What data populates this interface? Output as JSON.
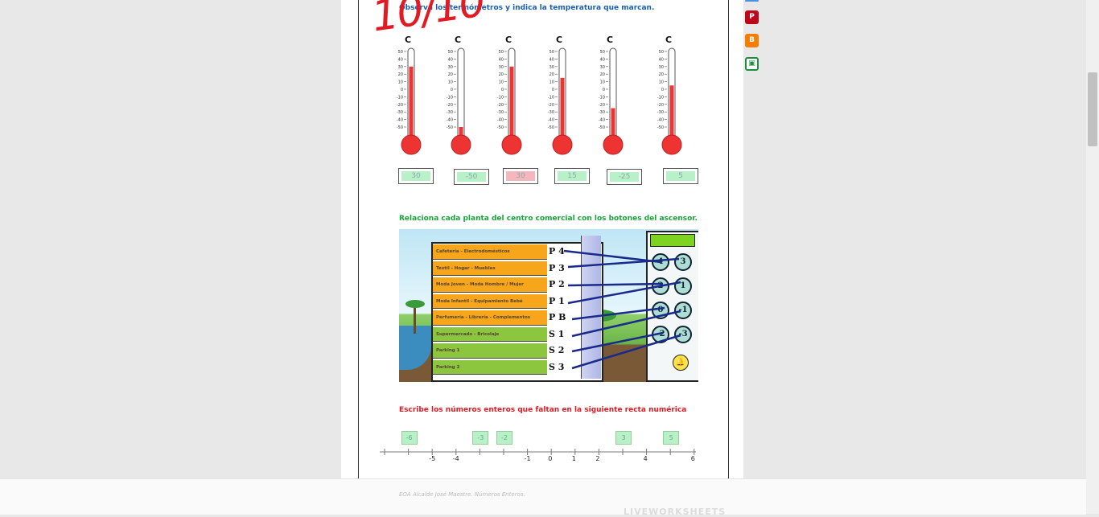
{
  "score": "10/10",
  "section1": {
    "instruction": "Observa los termómetros y indica la temperatura que marcan.",
    "scale_label": "C",
    "scale_ticks": [
      "50",
      "40",
      "30",
      "20",
      "10",
      "0",
      "-10",
      "-20",
      "-30",
      "-40",
      "-50"
    ],
    "thermometers": [
      {
        "reading": 30,
        "answer": "30",
        "correct": true
      },
      {
        "reading": -50,
        "answer": "-50",
        "correct": true
      },
      {
        "reading": 30,
        "answer": "30",
        "correct": false
      },
      {
        "reading": 15,
        "answer": "15",
        "correct": true
      },
      {
        "reading": -25,
        "answer": "-25",
        "correct": true
      },
      {
        "reading": 5,
        "answer": "5",
        "correct": true
      }
    ]
  },
  "section2": {
    "instruction": "Relaciona cada planta del centro comercial con los botones del ascensor.",
    "floors": [
      {
        "name": "Cafetería - Electrodomésticos",
        "label": "P 4"
      },
      {
        "name": "Textil - Hogar - Muebles",
        "label": "P 3"
      },
      {
        "name": "Moda Joven - Moda Hombre / Mujer",
        "label": "P 2"
      },
      {
        "name": "Moda Infantil - Equipamiento Bebé",
        "label": "P 1"
      },
      {
        "name": "Perfumería - Librería - Complementos",
        "label": "P B"
      },
      {
        "name": "Supermercado - Bricolaje",
        "label": "S 1"
      },
      {
        "name": "Parking 1",
        "label": "S 2"
      },
      {
        "name": "Parking 2",
        "label": "S 3"
      }
    ],
    "buttons": [
      "4",
      "3",
      "2",
      "1",
      "0",
      "-1",
      "-2",
      "-3"
    ]
  },
  "section3": {
    "instruction": "Escribe los números enteros que faltan en la siguiente recta numérica",
    "answers": [
      "-6",
      "-3",
      "-2",
      "3",
      "5"
    ],
    "labels": [
      "-5",
      "-4",
      "-1",
      "0",
      "1",
      "2",
      "4",
      "6"
    ]
  },
  "footer_credit": "EOA Alcalde José Maestre. Números Enteros.",
  "brand": "LIVEWORKSHEETS",
  "share_icons": [
    "pinterest-icon",
    "blogger-icon",
    "google-classroom-icon"
  ],
  "colors": {
    "instruction1": "#1a5fb4",
    "instruction2": "#19a33a",
    "instruction3": "#e01b24",
    "score": "#e01b24",
    "correct": "#b8f0c8",
    "wrong": "#f6b6bd"
  }
}
